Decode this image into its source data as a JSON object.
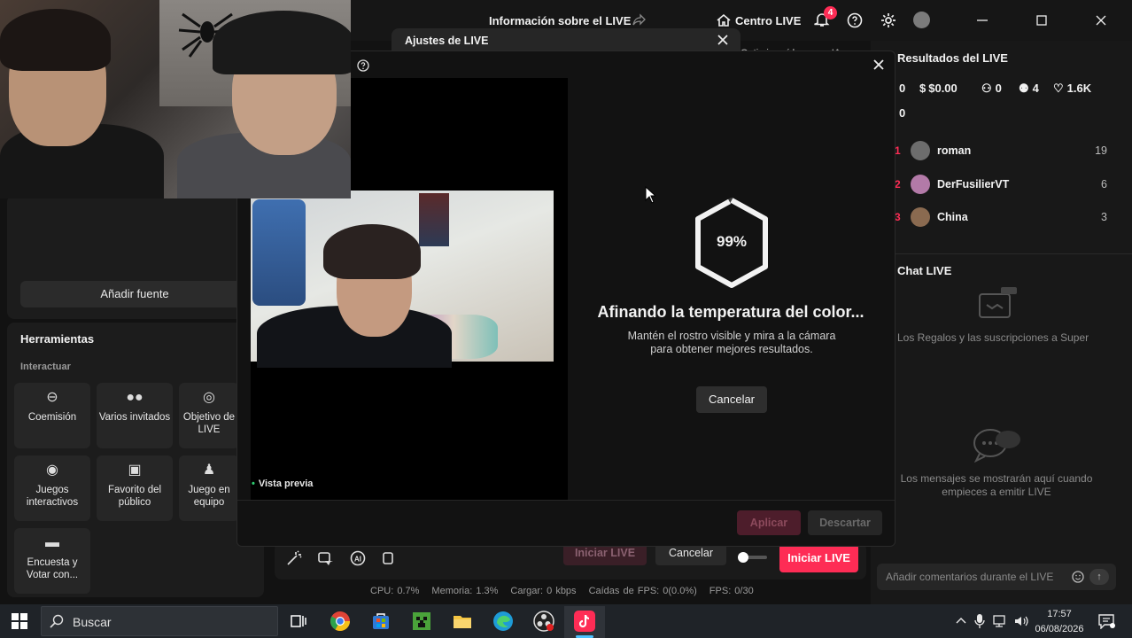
{
  "titlebar": {
    "live_info": "Información sobre el LIVE",
    "centro_live": "Centro LIVE",
    "notification_count": "4"
  },
  "ajustes": {
    "title": "Ajustes de LIVE",
    "optimize_tag": "Optimiza vídeos con IA"
  },
  "left": {
    "add_source": "Añadir fuente",
    "tools_title": "Herramientas",
    "interact_label": "Interactuar",
    "tools": [
      {
        "label": "Coemisión",
        "icon": "link-icon"
      },
      {
        "label": "Varios invitados",
        "icon": "group-icon"
      },
      {
        "label": "Objetivo de LIVE",
        "icon": "target-icon"
      },
      {
        "label": "Juegos interactivos",
        "icon": "gamepad-icon"
      },
      {
        "label": "Favorito del público",
        "icon": "gift-icon"
      },
      {
        "label": "Juego en equipo",
        "icon": "team-icon"
      },
      {
        "label": "Encuesta y Votar con...",
        "icon": "poll-icon"
      }
    ]
  },
  "right": {
    "results_title": "Resultados del LIVE",
    "stats": {
      "views": "0",
      "earnings": "$0.00",
      "viewers": "0",
      "new_followers": "4",
      "likes": "1.6K",
      "second_row": "0"
    },
    "ranking": [
      {
        "rank": "1",
        "name": "roman",
        "score": "19"
      },
      {
        "rank": "2",
        "name": "DerFusilierVT",
        "score": "6"
      },
      {
        "rank": "3",
        "name": "China",
        "score": "3"
      }
    ],
    "chat_title": "Chat LIVE",
    "gift_text": "Los Regalos y las suscripciones a Super",
    "chat_empty": "Los mensajes se mostrarán aquí cuando empieces a emitir LIVE",
    "comment_placeholder": "Añadir comentarios durante el LIVE"
  },
  "modal": {
    "preview_label": "Vista previa",
    "progress_percent": 99,
    "progress_text": "99%",
    "tuning_title": "Afinando la temperatura del color...",
    "tuning_desc_line1": "Mantén el rostro visible y mira a la cámara",
    "tuning_desc_line2": "para obtener mejores resultados.",
    "cancel": "Cancelar",
    "apply": "Aplicar",
    "discard": "Descartar"
  },
  "bottom": {
    "ghost_start": "Iniciar LIVE",
    "ghost_cancel": "Cancelar",
    "start_live": "Iniciar LIVE",
    "cpu": "CPU:  0.7%",
    "memory": "Memoria:  1.3%",
    "upload": "Cargar:  0 kbps",
    "fps_drops": "Caídas de FPS:  0(0.0%)",
    "fps": "FPS:  0/30"
  },
  "taskbar": {
    "search": "Buscar",
    "time": "17:57",
    "date": "06/08/2026"
  },
  "colors": {
    "accent": "#fe2c55",
    "background": "#121212"
  }
}
